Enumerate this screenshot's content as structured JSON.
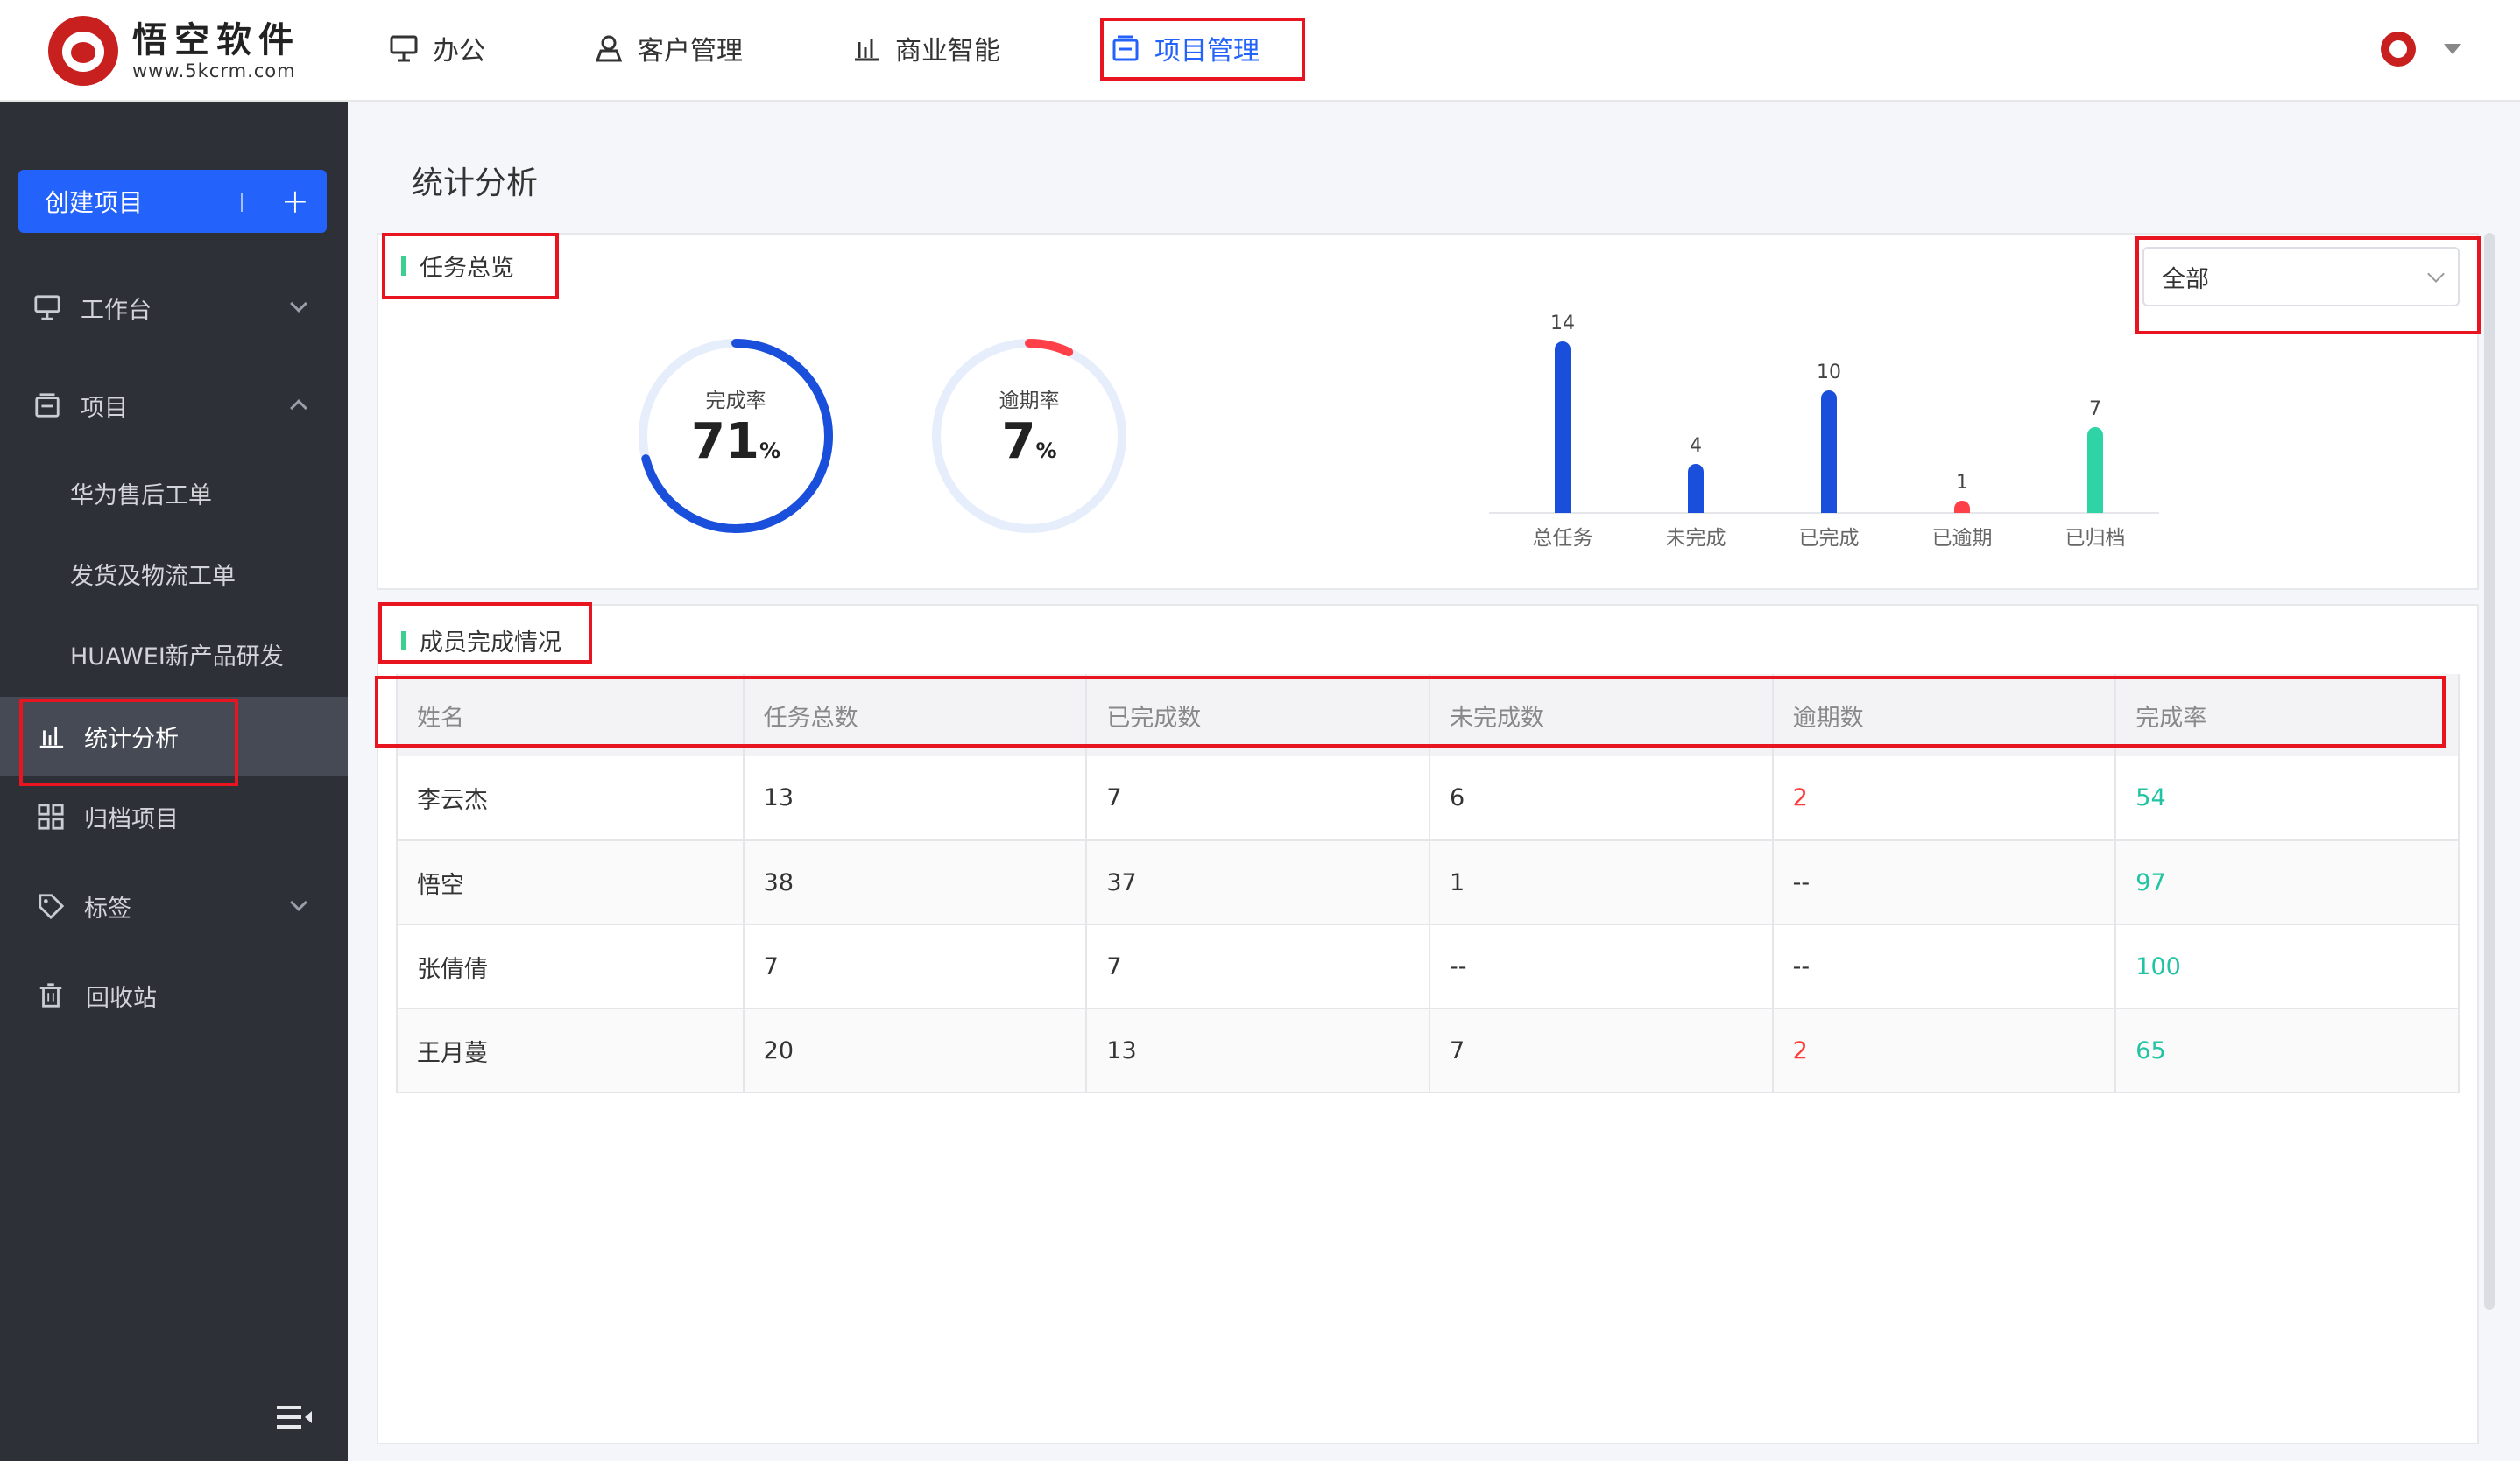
{
  "app": {
    "logo_name": "悟空软件",
    "logo_url": "www.5kcrm.com"
  },
  "topnav": [
    {
      "label": "办公",
      "icon": "monitor-icon"
    },
    {
      "label": "客户管理",
      "icon": "user-icon"
    },
    {
      "label": "商业智能",
      "icon": "bar-chart-icon"
    },
    {
      "label": "项目管理",
      "icon": "project-icon",
      "active": true
    }
  ],
  "sidebar": {
    "create_label": "创建项目",
    "create_icon": "plus-icon",
    "items": [
      {
        "label": "工作台",
        "icon": "monitor-icon",
        "expand": "collapsed"
      },
      {
        "label": "项目",
        "icon": "project-icon",
        "expand": "expanded"
      },
      {
        "label": "华为售后工单"
      },
      {
        "label": "发货及物流工单"
      },
      {
        "label": "HUAWEI新产品研发"
      },
      {
        "label": "统计分析",
        "icon": "bar-chart-icon",
        "active": true
      },
      {
        "label": "归档项目",
        "icon": "grid-icon"
      },
      {
        "label": "标签",
        "icon": "tag-icon",
        "expand": "collapsed"
      },
      {
        "label": "回收站",
        "icon": "trash-icon"
      }
    ]
  },
  "main": {
    "title": "统计分析",
    "overview": {
      "title": "任务总览",
      "filter_value": "全部",
      "completion": {
        "label": "完成率",
        "value": "71",
        "unit": "%",
        "fraction": 0.71,
        "color": "#1a4fdb"
      },
      "overdue": {
        "label": "逾期率",
        "value": "7",
        "unit": "%",
        "fraction": 0.07,
        "color": "#ff4048"
      }
    },
    "members": {
      "title": "成员完成情况",
      "columns": [
        "姓名",
        "任务总数",
        "已完成数",
        "未完成数",
        "逾期数",
        "完成率"
      ],
      "rows": [
        [
          "李云杰",
          "13",
          "7",
          "6",
          "2",
          "54"
        ],
        [
          "悟空",
          "38",
          "37",
          "1",
          "--",
          "97"
        ],
        [
          "张倩倩",
          "7",
          "7",
          "--",
          "--",
          "100"
        ],
        [
          "王月蔓",
          "20",
          "13",
          "7",
          "2",
          "65"
        ]
      ]
    }
  },
  "chart_data": {
    "type": "bar",
    "categories": [
      "总任务",
      "未完成",
      "已完成",
      "已逾期",
      "已归档"
    ],
    "values": [
      14,
      4,
      10,
      1,
      7
    ],
    "colors": [
      "#1a4fdb",
      "#1a4fdb",
      "#1a4fdb",
      "#ff4048",
      "#2ed4a6"
    ],
    "title": "",
    "xlabel": "",
    "ylabel": "",
    "ylim": [
      0,
      14
    ]
  }
}
